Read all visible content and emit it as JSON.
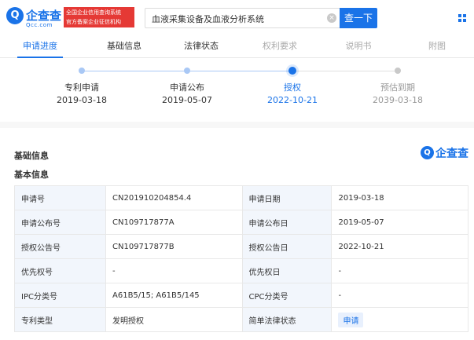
{
  "brand": {
    "name": "企查查",
    "sub": "Qcc.com",
    "badge_line1": "全国企业信用查询系统",
    "badge_line2": "官方备案企业征信机构"
  },
  "search": {
    "value": "血液采集设备及血液分析系统",
    "button_label": "查一下"
  },
  "tabs": [
    {
      "label": "申请进度",
      "state": "active"
    },
    {
      "label": "基础信息",
      "state": "normal"
    },
    {
      "label": "法律状态",
      "state": "normal"
    },
    {
      "label": "权利要求",
      "state": "disabled"
    },
    {
      "label": "说明书",
      "state": "disabled"
    },
    {
      "label": "附图",
      "state": "disabled"
    }
  ],
  "timeline": [
    {
      "label": "专利申请",
      "date": "2019-03-18",
      "state": "done"
    },
    {
      "label": "申请公布",
      "date": "2019-05-07",
      "state": "done"
    },
    {
      "label": "授权",
      "date": "2022-10-21",
      "state": "current"
    },
    {
      "label": "预估到期",
      "date": "2039-03-18",
      "state": "future"
    }
  ],
  "section": {
    "title": "基础信息",
    "subtitle": "基本信息",
    "watermark": "企查查"
  },
  "table": [
    {
      "k1": "申请号",
      "v1": "CN201910204854.4",
      "k2": "申请日期",
      "v2": "2019-03-18"
    },
    {
      "k1": "申请公布号",
      "v1": "CN109717877A",
      "k2": "申请公布日",
      "v2": "2019-05-07"
    },
    {
      "k1": "授权公告号",
      "v1": "CN109717877B",
      "k2": "授权公告日",
      "v2": "2022-10-21"
    },
    {
      "k1": "优先权号",
      "v1": "-",
      "k2": "优先权日",
      "v2": "-"
    },
    {
      "k1": "IPC分类号",
      "v1": "A61B5/15; A61B5/145",
      "k2": "CPC分类号",
      "v2": "-"
    },
    {
      "k1": "专利类型",
      "v1": "发明授权",
      "k2": "简单法律状态",
      "v2": "申请"
    }
  ],
  "colors": {
    "accent": "#1a73e8",
    "badge": "#e53935"
  }
}
